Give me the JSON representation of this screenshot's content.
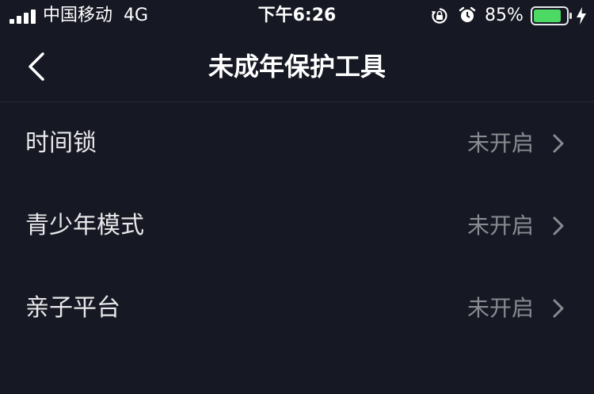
{
  "status_bar": {
    "carrier": "中国移动",
    "network": "4G",
    "time": "下午6:26",
    "battery_percent": "85%",
    "battery_level": 0.85,
    "icons": [
      "signal-icon",
      "orientation-lock-icon",
      "alarm-icon",
      "battery-icon",
      "charging-icon"
    ]
  },
  "nav": {
    "back_icon": "chevron-left-icon",
    "title": "未成年保护工具"
  },
  "items": [
    {
      "label": "时间锁",
      "status": "未开启"
    },
    {
      "label": "青少年模式",
      "status": "未开启"
    },
    {
      "label": "亲子平台",
      "status": "未开启"
    }
  ],
  "colors": {
    "background": "#161823",
    "divider": "#262833",
    "primary_text": "#ffffff",
    "secondary_text": "#8a8b91",
    "battery_fill": "#4cd964"
  }
}
